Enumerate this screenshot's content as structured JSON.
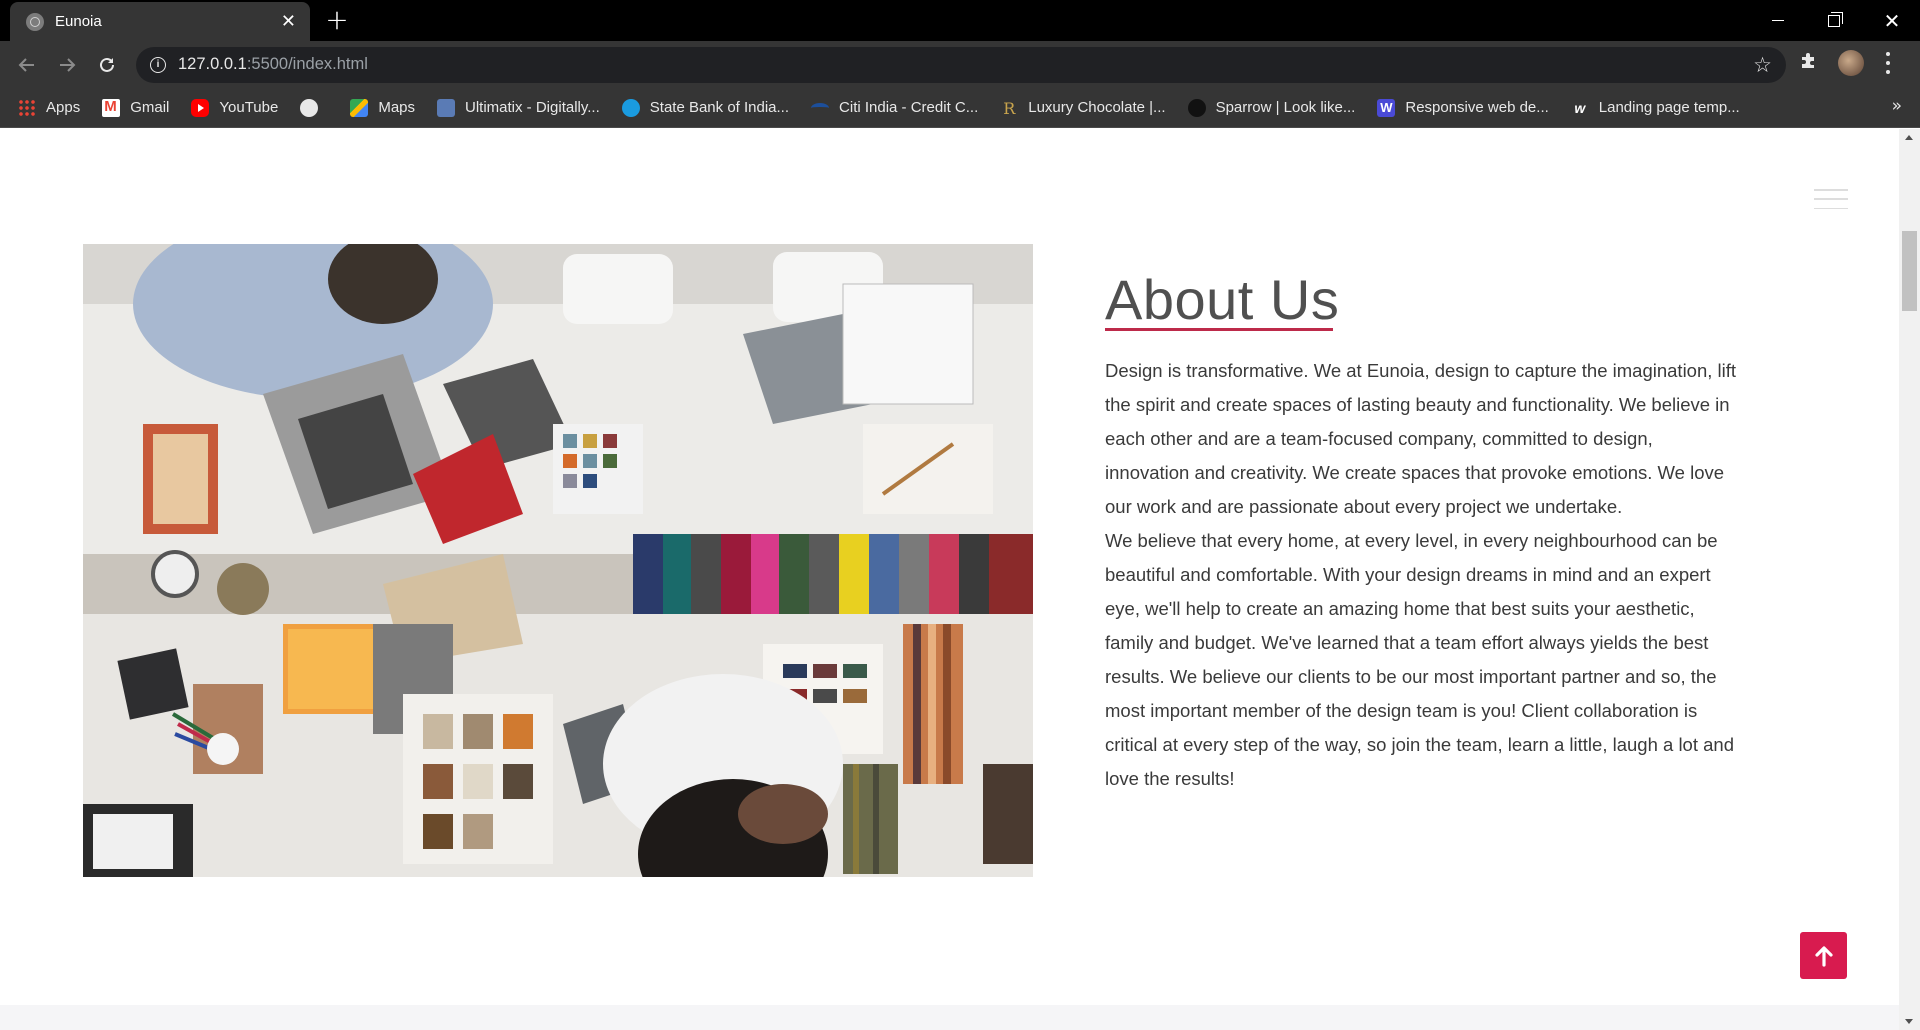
{
  "browser": {
    "tab_title": "Eunoia",
    "url_host": "127.0.0.1",
    "url_path": ":5500/index.html",
    "bookmarks": [
      {
        "label": "Apps",
        "icon": "apps-grid-icon"
      },
      {
        "label": "Gmail",
        "icon": "gmail-icon"
      },
      {
        "label": "YouTube",
        "icon": "youtube-icon"
      },
      {
        "label": "",
        "icon": "globe-icon"
      },
      {
        "label": "Maps",
        "icon": "maps-icon"
      },
      {
        "label": "Ultimatix - Digitally...",
        "icon": "ultimatix-icon"
      },
      {
        "label": "State Bank of India...",
        "icon": "sbi-icon"
      },
      {
        "label": "Citi India - Credit C...",
        "icon": "citi-icon"
      },
      {
        "label": "Luxury Chocolate |...",
        "icon": "r-logo-icon"
      },
      {
        "label": "Sparrow | Look like...",
        "icon": "sparrow-icon"
      },
      {
        "label": "Responsive web de...",
        "icon": "w-logo-icon"
      },
      {
        "label": "Landing page temp...",
        "icon": "w-italic-icon"
      }
    ],
    "more_bookmarks": "»"
  },
  "about": {
    "title": "About Us",
    "accent_color": "#bd2a4a",
    "paragraph_1": "Design is transformative. We at Eunoia, design to capture the imagination, lift the spirit and create spaces of lasting beauty and functionality. We believe in each other and are a team-focused company, committed to design, innovation and creativity. We create spaces that provoke emotions. We love our work and are passionate about every project we undertake.",
    "paragraph_2": "We believe that every home, at every level, in every neighbourhood can be beautiful and comfortable. With your design dreams in mind and an expert eye, we'll help to create an amazing home that best suits your aesthetic, family and budget. We've learned that a team effort always yields the best results. We believe our clients to be our most important partner and so, the most important member of the design team is you! Client collaboration is critical at every step of the way, so join the team, learn a little, laugh a lot and love the results!"
  },
  "back_to_top": {
    "icon": "arrow-up-icon",
    "color": "#d81b4f"
  }
}
